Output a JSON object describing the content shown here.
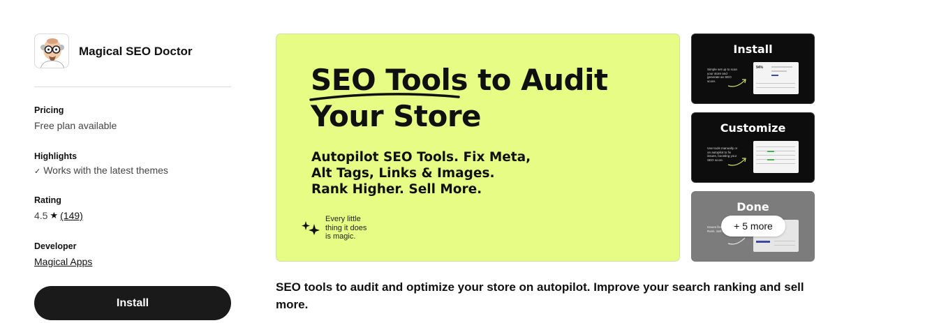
{
  "app": {
    "name": "Magical SEO Doctor"
  },
  "sidebar": {
    "pricing_label": "Pricing",
    "pricing_value": "Free plan available",
    "highlights_label": "Highlights",
    "highlights_value": "Works with the latest themes",
    "rating_label": "Rating",
    "rating_value": "4.5",
    "rating_count": "(149)",
    "developer_label": "Developer",
    "developer_value": "Magical Apps",
    "install_label": "Install"
  },
  "hero": {
    "title_line1_a": "SEO Tools",
    "title_line1_b": " to Audit",
    "title_line2": "Your Store",
    "sub_line1": "Autopilot SEO Tools. Fix Meta,",
    "sub_line2": "Alt Tags, Links & Images.",
    "sub_line3": "Rank Higher. Sell More.",
    "tagline_1": "Every little",
    "tagline_2": "thing it does",
    "tagline_3": "is magic."
  },
  "thumbnails": [
    {
      "title": "Install",
      "text": "Simple set up to scan your store and generate an SEO score."
    },
    {
      "title": "Customize",
      "text": "Use tools manually or on autopilot to fix issues, boosting your SEO score."
    },
    {
      "title": "Done",
      "text": "Issues fixed. Boosted. Rank. Sell More."
    }
  ],
  "more_label": "+ 5 more",
  "description": "SEO tools to audit and optimize your store on autopilot. Improve your search ranking and sell more.",
  "colors": {
    "hero_bg": "#e6fc84",
    "button_bg": "#1a1a1a"
  },
  "icons": [
    "doctor-avatar-icon",
    "check-icon",
    "star-icon",
    "sparkle-icon"
  ]
}
